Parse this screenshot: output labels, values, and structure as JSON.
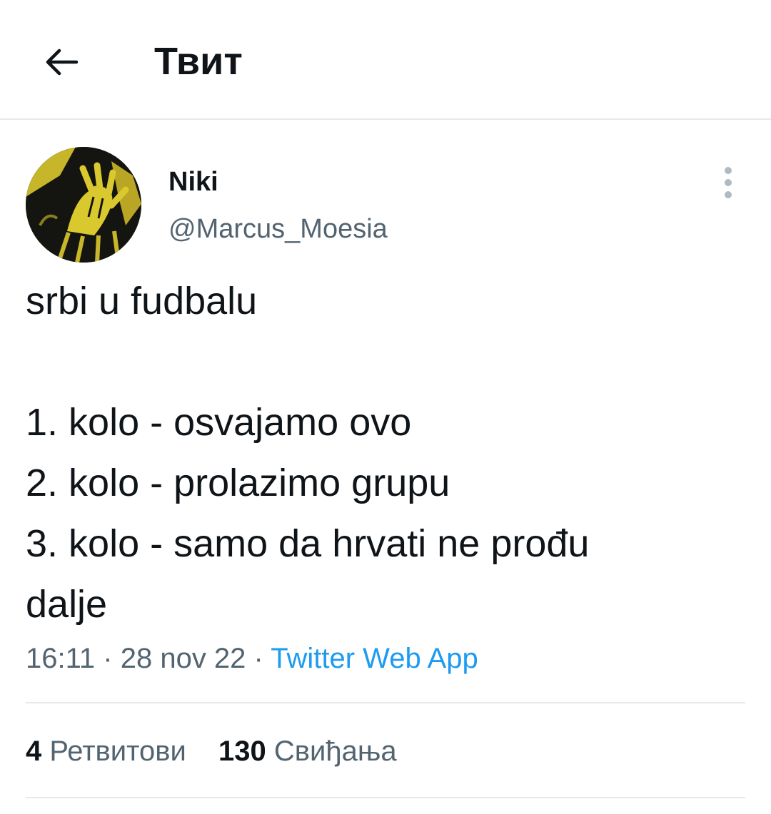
{
  "header": {
    "title": "Твит",
    "back_icon": "arrow-left-icon"
  },
  "author": {
    "display_name": "Niki",
    "handle": "@Marcus_Moesia",
    "avatar_icon": "profile-avatar",
    "more_icon": "more-vertical-icon"
  },
  "tweet": {
    "lines": [
      "srbi u fudbalu",
      "",
      "1. kolo - osvajamo ovo",
      "2. kolo - prolazimo grupu",
      "3. kolo - samo da hrvati ne prođu",
      "dalje"
    ],
    "time": "16:11",
    "separator": "·",
    "date": "28 nov 22",
    "source": "Twitter Web App"
  },
  "stats": {
    "retweets_count": "4",
    "retweets_label": "Ретвитови",
    "likes_count": "130",
    "likes_label": "Свиђања"
  },
  "colors": {
    "text": "#0f1419",
    "secondary": "#536471",
    "link": "#1d9bf0",
    "divider": "#e6e9ec"
  }
}
